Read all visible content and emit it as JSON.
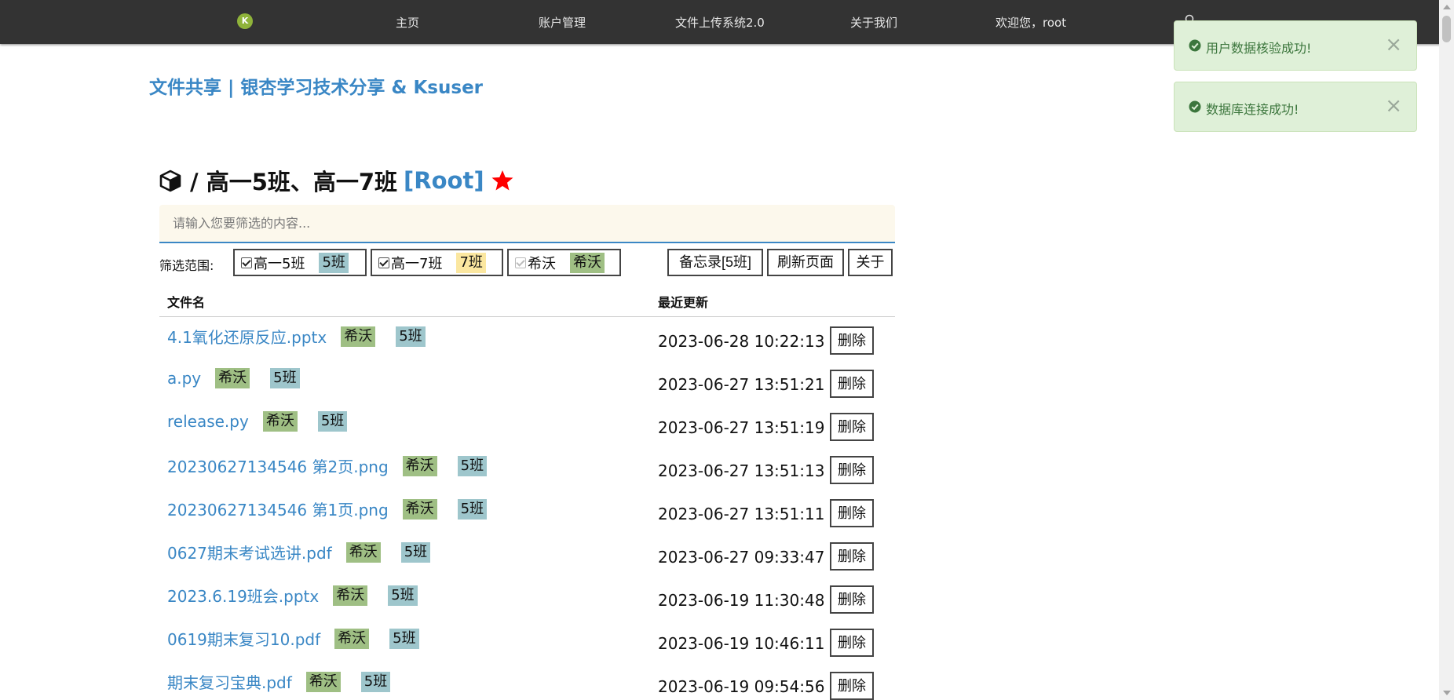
{
  "nav": {
    "logo_glyph": "K",
    "links": [
      {
        "label": "主页"
      },
      {
        "label": "账户管理"
      },
      {
        "label": "文件上传系统2.0"
      },
      {
        "label": "关于我们"
      },
      {
        "label": "欢迎您，root"
      }
    ],
    "search_icon": "search-icon"
  },
  "site_title": "文件共享 | 银杏学习技术分享 & Ksuser",
  "toasts": [
    {
      "message": "用户数据核验成功!",
      "close": "×"
    },
    {
      "message": "数据库连接成功!",
      "close": "×"
    }
  ],
  "heading": {
    "icon": "cube-icon",
    "path": "/ 高一5班、高一7班",
    "role": "[Root]",
    "star_icon": "star-icon"
  },
  "filter": {
    "placeholder": "请输入您要筛选的内容...",
    "value": ""
  },
  "range": {
    "label": "筛选范围:",
    "options": [
      {
        "name": "高一5班",
        "tag": "5班",
        "checked": true,
        "disabled": false
      },
      {
        "name": "高一7班",
        "tag": "7班",
        "checked": true,
        "disabled": false
      },
      {
        "name": "希沃",
        "tag": "希沃",
        "checked": true,
        "disabled": true
      }
    ]
  },
  "toolbar": {
    "memo_label": "备忘录[5班]",
    "refresh_label": "刷新页面",
    "about_label": "关于"
  },
  "table": {
    "headers": {
      "name": "文件名",
      "updated": "最近更新"
    },
    "delete_label": "删除",
    "rows": [
      {
        "name": "4.1氧化还原反应.pptx",
        "tags": [
          "希沃",
          "5班"
        ],
        "updated": "2023-06-28 10:22:13"
      },
      {
        "name": "a.py",
        "tags": [
          "希沃",
          "5班"
        ],
        "updated": "2023-06-27 13:51:21"
      },
      {
        "name": "release.py",
        "tags": [
          "希沃",
          "5班"
        ],
        "updated": "2023-06-27 13:51:19"
      },
      {
        "name": "20230627134546 第2页.png",
        "tags": [
          "希沃",
          "5班"
        ],
        "updated": "2023-06-27 13:51:13"
      },
      {
        "name": "20230627134546 第1页.png",
        "tags": [
          "希沃",
          "5班"
        ],
        "updated": "2023-06-27 13:51:11"
      },
      {
        "name": "0627期末考试选讲.pdf",
        "tags": [
          "希沃",
          "5班"
        ],
        "updated": "2023-06-27 09:33:47"
      },
      {
        "name": "2023.6.19班会.pptx",
        "tags": [
          "希沃",
          "5班"
        ],
        "updated": "2023-06-19 11:30:48"
      },
      {
        "name": "0619期末复习10.pdf",
        "tags": [
          "希沃",
          "5班"
        ],
        "updated": "2023-06-19 10:46:11"
      },
      {
        "name": "期末复习宝典.pdf",
        "tags": [
          "希沃",
          "5班"
        ],
        "updated": "2023-06-19 09:54:56"
      }
    ]
  },
  "colors": {
    "nav_bg": "#333333",
    "link": "#3a87c5",
    "tag_5": "#9ec6cc",
    "tag_7": "#fbe7a0",
    "tag_xiwo": "#9fbf84",
    "toast_bg": "#dff0d8",
    "toast_text": "#3c763d",
    "star": "#ff0000"
  }
}
